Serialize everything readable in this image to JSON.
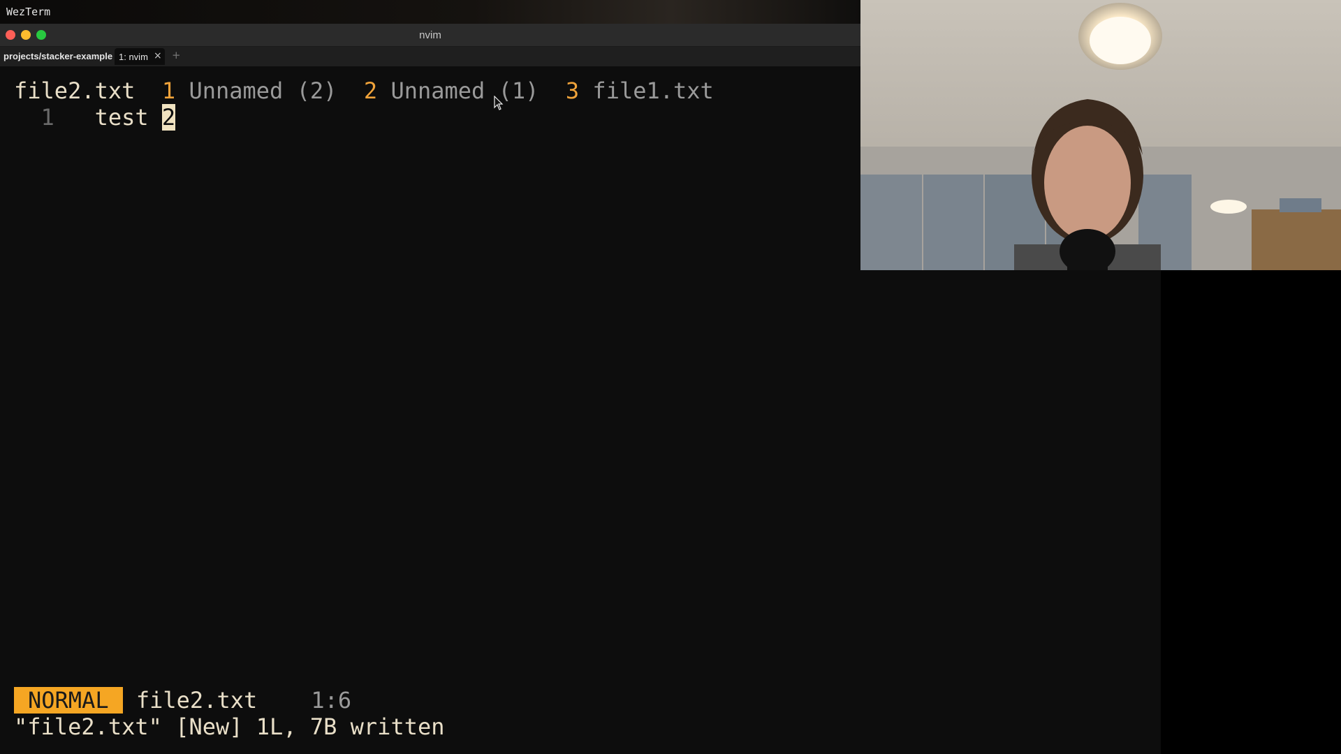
{
  "menubar": {
    "app_name": "WezTerm"
  },
  "window": {
    "title": "nvim"
  },
  "tabbar": {
    "cwd": "projects/stacker-example",
    "active_tab": "1: nvim",
    "close_icon": "×",
    "new_tab_icon": "+"
  },
  "editor": {
    "bufferline": {
      "current": "file2.txt",
      "buffers": [
        {
          "num": "1",
          "name": "Unnamed (2)"
        },
        {
          "num": "2",
          "name": "Unnamed (1)"
        },
        {
          "num": "3",
          "name": "file1.txt"
        }
      ]
    },
    "lines": [
      {
        "number": "1",
        "text_before_cursor": "test ",
        "cursor_char": "2"
      }
    ],
    "statusline": {
      "mode": "NORMAL",
      "filename": "file2.txt",
      "position": "1:6"
    },
    "message": "\"file2.txt\" [New] 1L, 7B written"
  },
  "colors": {
    "mode_bg": "#f5a623",
    "buffer_number": "#f0a33a",
    "text": "#e9dfc8",
    "dim": "#9a9a9a",
    "background": "#0d0d0d"
  }
}
